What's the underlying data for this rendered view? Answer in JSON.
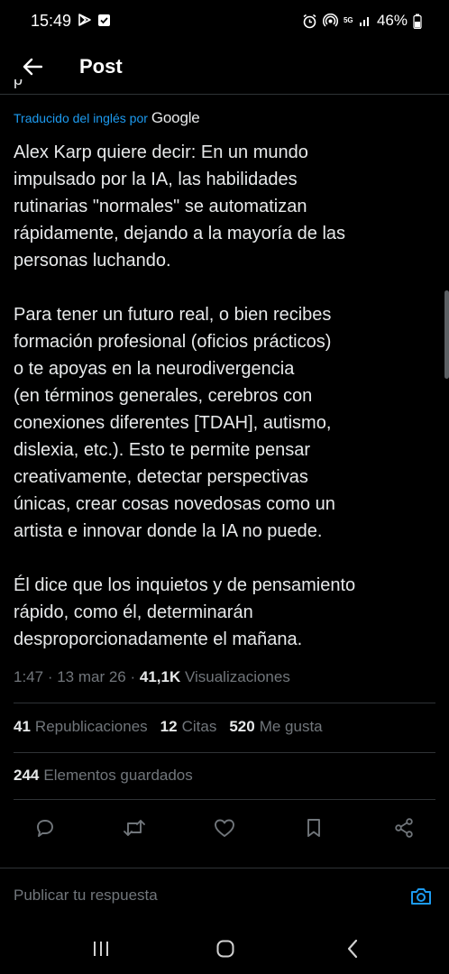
{
  "status_bar": {
    "time": "15:49",
    "battery": "46%",
    "network": "5G"
  },
  "header": {
    "title": "Post"
  },
  "translation": {
    "label": "Traducido del inglés por",
    "provider": "Google"
  },
  "post": {
    "paragraphs": [
      [
        "Alex Karp quiere decir: En un mundo",
        "impulsado por la IA, las habilidades",
        "rutinarias \"normales\" se automatizan",
        "rápidamente, dejando a la mayoría de las",
        "personas luchando."
      ],
      [
        "Para tener un futuro real, o bien recibes",
        "formación profesional (oficios prácticos)",
        "o te apoyas en la neurodivergencia",
        "(en términos generales, cerebros con",
        "conexiones diferentes [TDAH], autismo,",
        "dislexia, etc.). Esto te permite pensar",
        "creativamente, detectar perspectivas",
        "únicas, crear cosas novedosas como un",
        "artista e innovar donde la IA no puede."
      ],
      [
        "Él dice que los inquietos y de pensamiento",
        "rápido, como él, determinarán",
        "desproporcionadamente el mañana."
      ]
    ]
  },
  "meta": {
    "time": "1:47",
    "separator": " · ",
    "date": "13 mar 26",
    "views_count": "41,1K",
    "views_label": "Visualizaciones"
  },
  "stats": {
    "reposts_count": "41",
    "reposts_label": "Republicaciones",
    "quotes_count": "12",
    "quotes_label": "Citas",
    "likes_count": "520",
    "likes_label": "Me gusta",
    "bookmarks_count": "244",
    "bookmarks_label": "Elementos guardados"
  },
  "actions": [
    "reply-icon",
    "repost-icon",
    "like-icon",
    "bookmark-icon",
    "share-icon"
  ],
  "reply": {
    "placeholder": "Publicar tu respuesta"
  },
  "colors": {
    "background": "#000000",
    "text": "#e7e9ea",
    "secondary": "#71767b",
    "accent": "#1d9bf0",
    "divider": "#2f3336"
  }
}
